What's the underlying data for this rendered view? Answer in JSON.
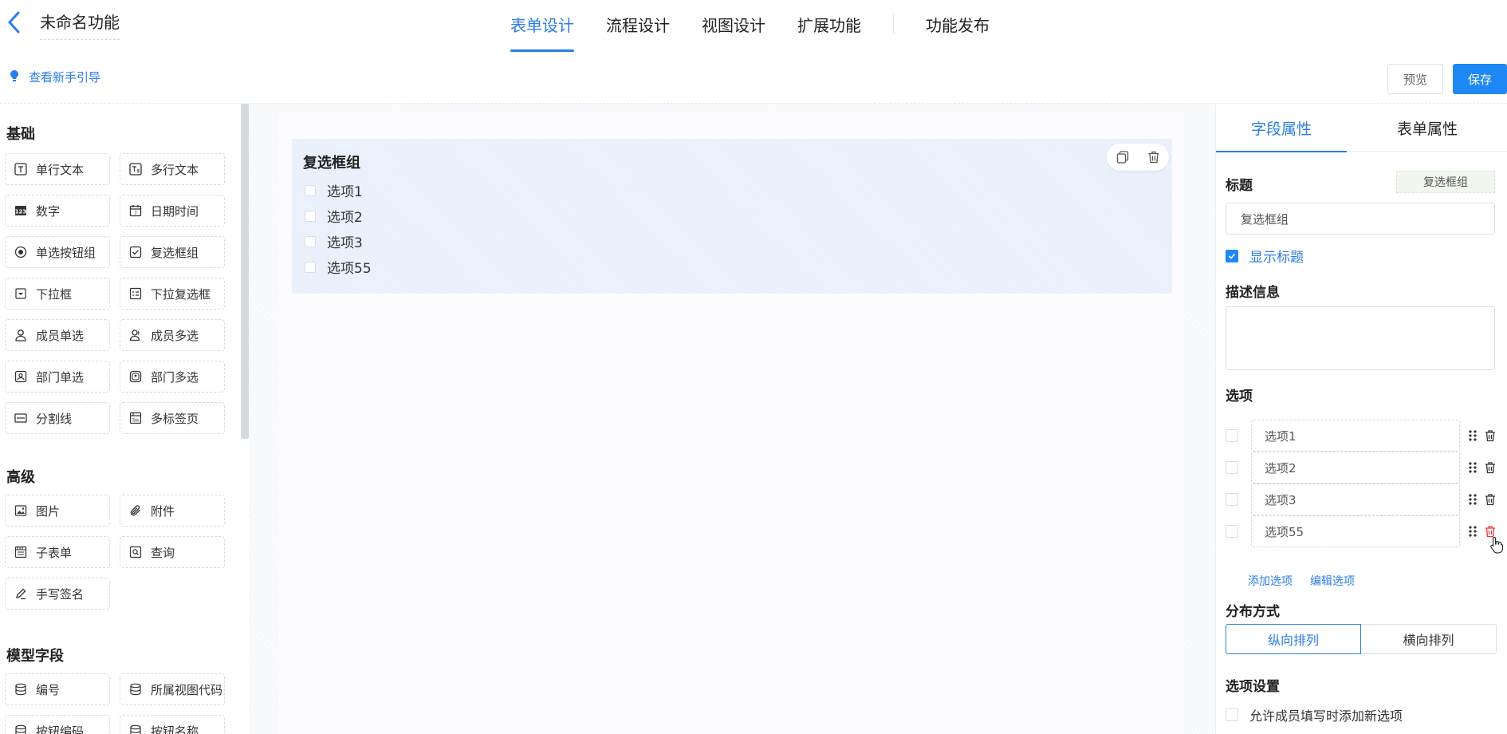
{
  "header": {
    "title": "未命名功能",
    "tabs": [
      {
        "label": "表单设计",
        "active": true
      },
      {
        "label": "流程设计",
        "active": false
      },
      {
        "label": "视图设计",
        "active": false
      },
      {
        "label": "扩展功能",
        "active": false
      },
      {
        "label": "功能发布",
        "active": false
      }
    ],
    "guide_link": "查看新手引导",
    "preview_label": "预览",
    "save_label": "保存",
    "accent_color": "#2b7de9"
  },
  "palette": {
    "groups": [
      {
        "title": "基础",
        "items": [
          "单行文本",
          "多行文本",
          "数字",
          "日期时间",
          "单选按钮组",
          "复选框组",
          "下拉框",
          "下拉复选框",
          "成员单选",
          "成员多选",
          "部门单选",
          "部门多选",
          "分割线",
          "多标签页"
        ]
      },
      {
        "title": "高级",
        "items": [
          "图片",
          "附件",
          "子表单",
          "查询",
          "手写签名"
        ]
      },
      {
        "title": "模型字段",
        "items": [
          "编号",
          "所属视图代码",
          "按钮编码",
          "按钮名称"
        ]
      }
    ]
  },
  "canvas": {
    "field": {
      "title": "复选框组",
      "options": [
        "选项1",
        "选项2",
        "选项3",
        "选项55"
      ]
    }
  },
  "props": {
    "tabs": [
      "字段属性",
      "表单属性"
    ],
    "title_label": "标题",
    "type_tag": "复选框组",
    "title_value": "复选框组",
    "show_title_label": "显示标题",
    "desc_label": "描述信息",
    "options_label": "选项",
    "options": [
      "选项1",
      "选项2",
      "选项3",
      "选项55"
    ],
    "add_option": "添加选项",
    "edit_options": "编辑选项",
    "layout_label": "分布方式",
    "layout_vertical": "纵向排列",
    "layout_horizontal": "横向排列",
    "settings_label": "选项设置",
    "allow_new_label": "允许成员填写时添加新选项"
  }
}
